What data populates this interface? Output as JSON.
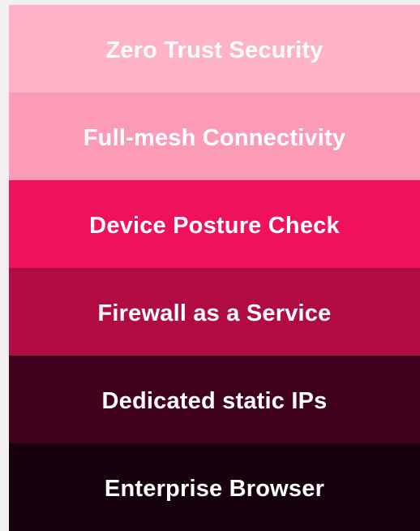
{
  "features": [
    {
      "label": "Zero Trust Security",
      "color": "#ffb3c8"
    },
    {
      "label": "Full-mesh Connectivity",
      "color": "#fb9bb8"
    },
    {
      "label": "Device Posture Check",
      "color": "#ef125b"
    },
    {
      "label": "Firewall as a Service",
      "color": "#b10c42"
    },
    {
      "label": "Dedicated static IPs",
      "color": "#3f011b"
    },
    {
      "label": "Enterprise Browser",
      "color": "#17010d"
    }
  ]
}
